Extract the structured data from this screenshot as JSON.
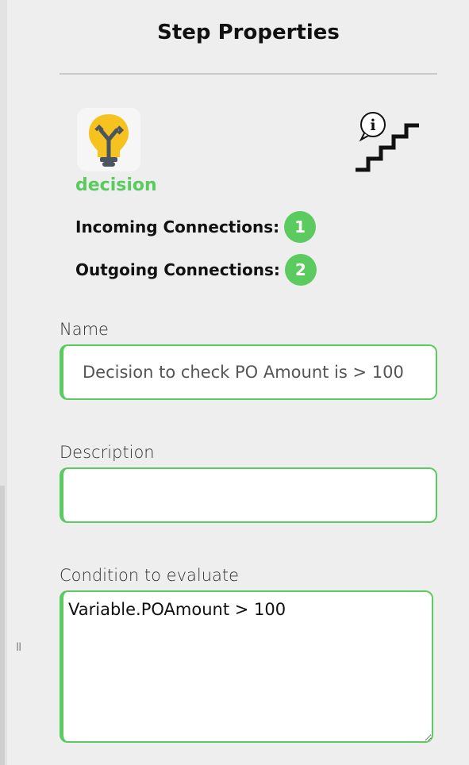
{
  "panel": {
    "title": "Step Properties"
  },
  "step": {
    "type": "decision",
    "icon": "decision-bulb-icon",
    "helper_icon": "info-stairs-icon",
    "type_color": "#5ccb5f"
  },
  "connections": {
    "incoming_label": "Incoming Connections:",
    "incoming_count": "1",
    "outgoing_label": "Outgoing Connections:",
    "outgoing_count": "2"
  },
  "fields": {
    "name_label": "Name",
    "name_value": "Decision to check PO Amount is > 100",
    "description_label": "Description",
    "description_value": "",
    "condition_label": "Condition to evaluate",
    "condition_value": "Variable.POAmount > 100"
  },
  "sidebar": {
    "grip_icon": "resize-grip-icon",
    "grip_glyph": "II"
  },
  "colors": {
    "accent": "#5ccb5f",
    "background": "#eeeeee"
  }
}
